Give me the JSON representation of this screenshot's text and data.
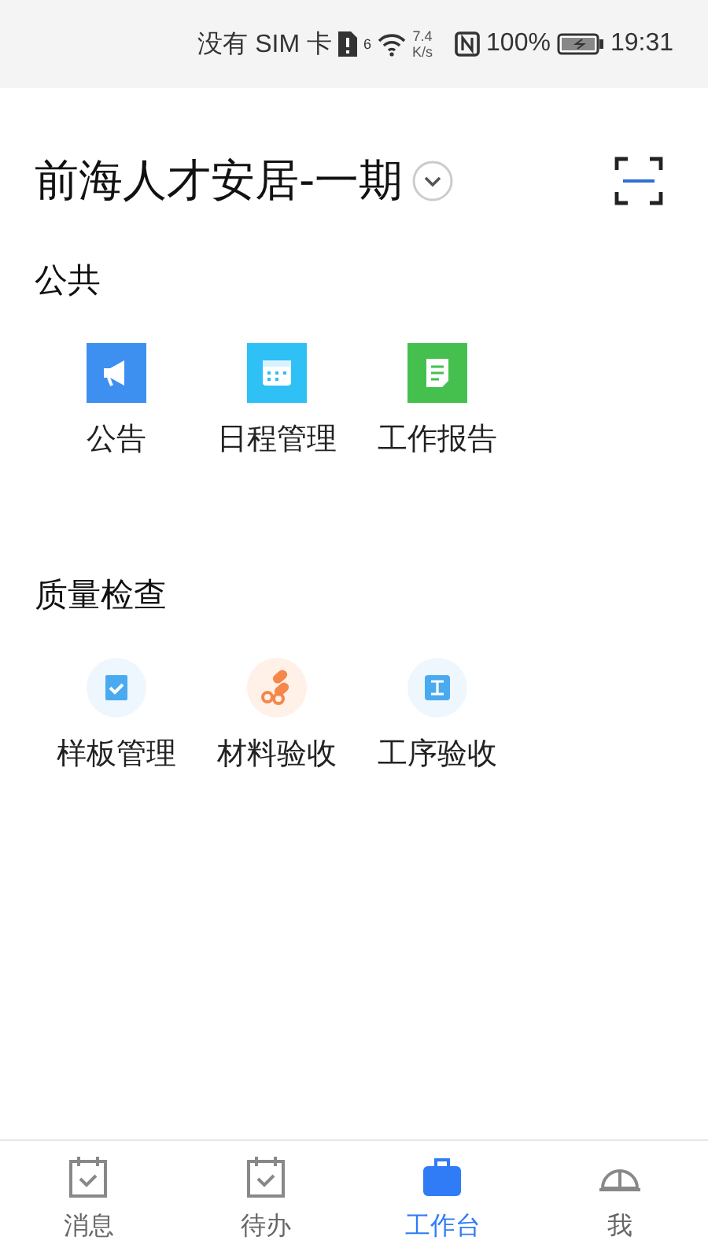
{
  "status_bar": {
    "carrier": "没有 SIM 卡",
    "wifi_badge": "6",
    "speed_value": "7.4",
    "speed_unit": "K/s",
    "battery": "100%",
    "time": "19:31"
  },
  "header": {
    "title": "前海人才安居-一期"
  },
  "sections": [
    {
      "title": "公共",
      "items": [
        {
          "label": "公告"
        },
        {
          "label": "日程管理"
        },
        {
          "label": "工作报告"
        }
      ]
    },
    {
      "title": "质量检查",
      "items": [
        {
          "label": "样板管理"
        },
        {
          "label": "材料验收"
        },
        {
          "label": "工序验收"
        }
      ]
    }
  ],
  "tabs": [
    {
      "label": "消息",
      "selected": false
    },
    {
      "label": "待办",
      "selected": false
    },
    {
      "label": "工作台",
      "selected": true
    },
    {
      "label": "我",
      "selected": false
    }
  ]
}
